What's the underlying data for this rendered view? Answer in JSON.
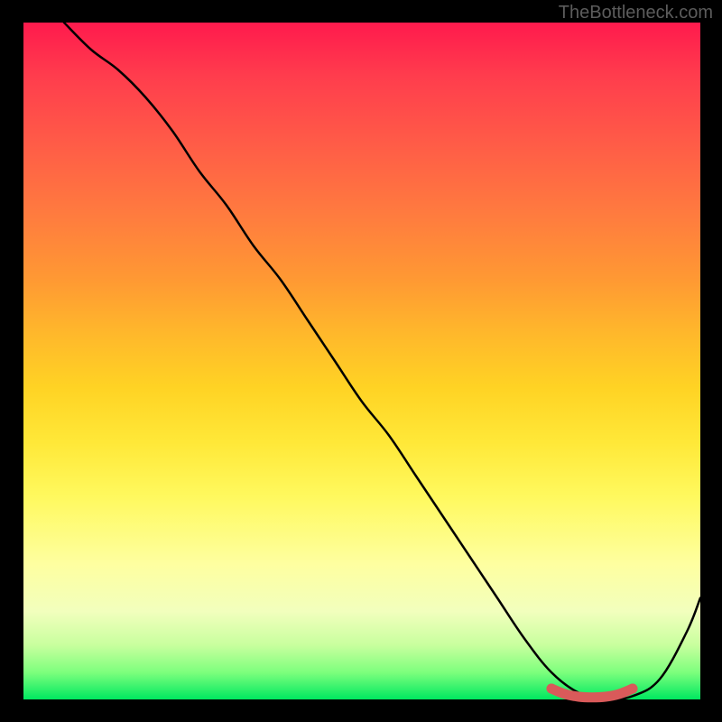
{
  "watermark": "TheBottleneck.com",
  "chart_data": {
    "type": "line",
    "title": "",
    "xlabel": "",
    "ylabel": "",
    "xlim": [
      0,
      100
    ],
    "ylim": [
      0,
      100
    ],
    "grid": false,
    "series": [
      {
        "name": "main-curve",
        "color": "#000000",
        "x": [
          6,
          10,
          14,
          18,
          22,
          26,
          30,
          34,
          38,
          42,
          46,
          50,
          54,
          58,
          62,
          66,
          70,
          74,
          78,
          82,
          86,
          90,
          94,
          98,
          100
        ],
        "values": [
          100,
          96,
          93,
          89,
          84,
          78,
          73,
          67,
          62,
          56,
          50,
          44,
          39,
          33,
          27,
          21,
          15,
          9,
          4,
          1,
          0,
          0.5,
          3,
          10,
          15
        ]
      },
      {
        "name": "highlight-segment",
        "color": "#d95a5a",
        "x": [
          78,
          80,
          82,
          84,
          86,
          88,
          90
        ],
        "values": [
          1.6,
          0.8,
          0.4,
          0.3,
          0.4,
          0.8,
          1.6
        ]
      }
    ]
  }
}
